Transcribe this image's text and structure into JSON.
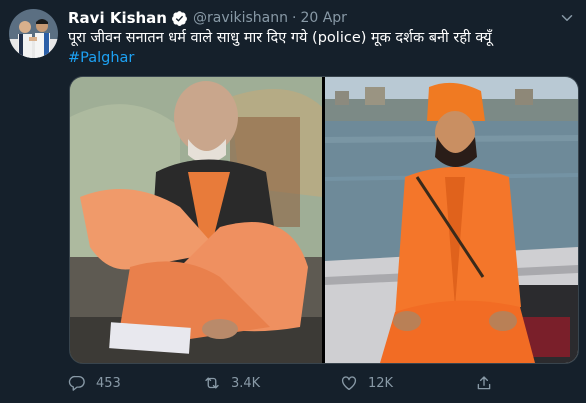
{
  "tweet": {
    "author_name": "Ravi Kishan",
    "handle": "@ravikishann",
    "separator": "·",
    "date": "20 Apr",
    "text": "पूरा जीवन सनातन धर्म वाले साधु मार दिए गये (police) मूक दर्शक बनी रही क्यूँ",
    "hashtag": "#Palghar"
  },
  "actions": {
    "reply_count": "453",
    "retweet_count": "3.4K",
    "like_count": "12K"
  },
  "colors": {
    "background": "#15202b",
    "secondary_text": "#8899a6",
    "accent": "#1da1f2"
  },
  "icons": [
    "verified-badge-icon",
    "chevron-down-icon",
    "reply-icon",
    "retweet-icon",
    "like-icon",
    "share-icon"
  ]
}
